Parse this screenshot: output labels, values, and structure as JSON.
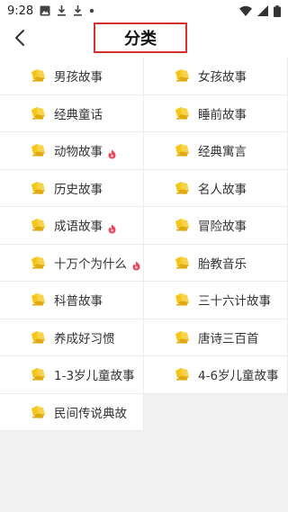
{
  "status_bar": {
    "time": "9:28",
    "icons": [
      "image-icon",
      "download-icon",
      "download-icon",
      "dot-icon"
    ],
    "right_icons": [
      "wifi-icon",
      "signal-icon",
      "battery-icon"
    ]
  },
  "header": {
    "back_icon": "chevron-left-icon",
    "title": "分类"
  },
  "colors": {
    "highlight_border": "#d9302c",
    "book_icon": "#f5c518",
    "hot_badge": "#e84a5f"
  },
  "categories": [
    {
      "label": "男孩故事",
      "hot": false
    },
    {
      "label": "女孩故事",
      "hot": false
    },
    {
      "label": "经典童话",
      "hot": false
    },
    {
      "label": "睡前故事",
      "hot": false
    },
    {
      "label": "动物故事",
      "hot": true
    },
    {
      "label": "经典寓言",
      "hot": false
    },
    {
      "label": "历史故事",
      "hot": false
    },
    {
      "label": "名人故事",
      "hot": false
    },
    {
      "label": "成语故事",
      "hot": true
    },
    {
      "label": "冒险故事",
      "hot": false
    },
    {
      "label": "十万个为什么",
      "hot": true
    },
    {
      "label": "胎教音乐",
      "hot": false
    },
    {
      "label": "科普故事",
      "hot": false
    },
    {
      "label": "三十六计故事",
      "hot": false
    },
    {
      "label": "养成好习惯",
      "hot": false
    },
    {
      "label": "唐诗三百首",
      "hot": false
    },
    {
      "label": "1-3岁儿童故事",
      "hot": false
    },
    {
      "label": "4-6岁儿童故事",
      "hot": false
    },
    {
      "label": "民间传说典故",
      "hot": false
    }
  ]
}
